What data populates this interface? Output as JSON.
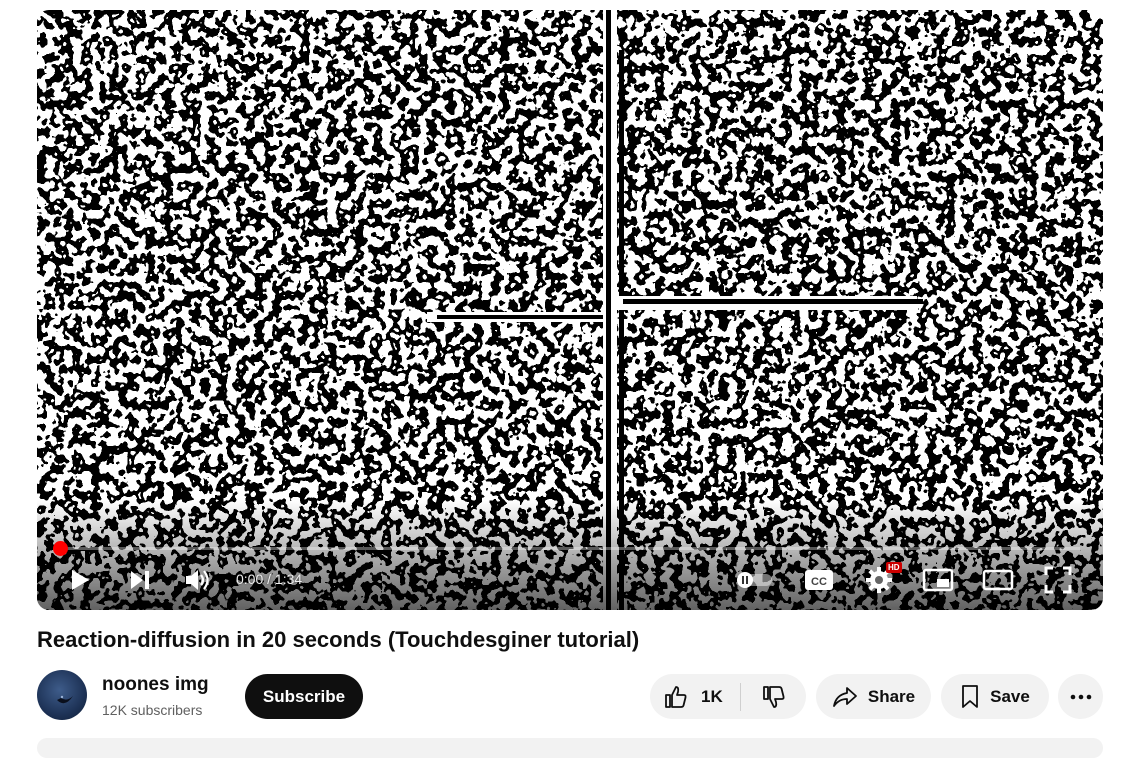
{
  "player": {
    "time_display": "0:00 / 1:34",
    "progress": 0.0,
    "hd_badge": "HD",
    "icons": [
      "play-icon",
      "next-icon",
      "volume-icon",
      "autoplay-toggle-icon",
      "captions-icon",
      "settings-icon",
      "miniplayer-icon",
      "theater-icon",
      "fullscreen-icon"
    ]
  },
  "video": {
    "title": "Reaction-diffusion in 20 seconds (Touchdesginer tutorial)"
  },
  "channel": {
    "name": "noones img",
    "subscribers": "12K subscribers",
    "subscribe_label": "Subscribe"
  },
  "actions": {
    "like_count": "1K",
    "share_label": "Share",
    "save_label": "Save"
  },
  "colors": {
    "accent": "#ff0000",
    "subscribe_bg": "#0f0f0f",
    "pill_bg": "#f2f2f2"
  }
}
